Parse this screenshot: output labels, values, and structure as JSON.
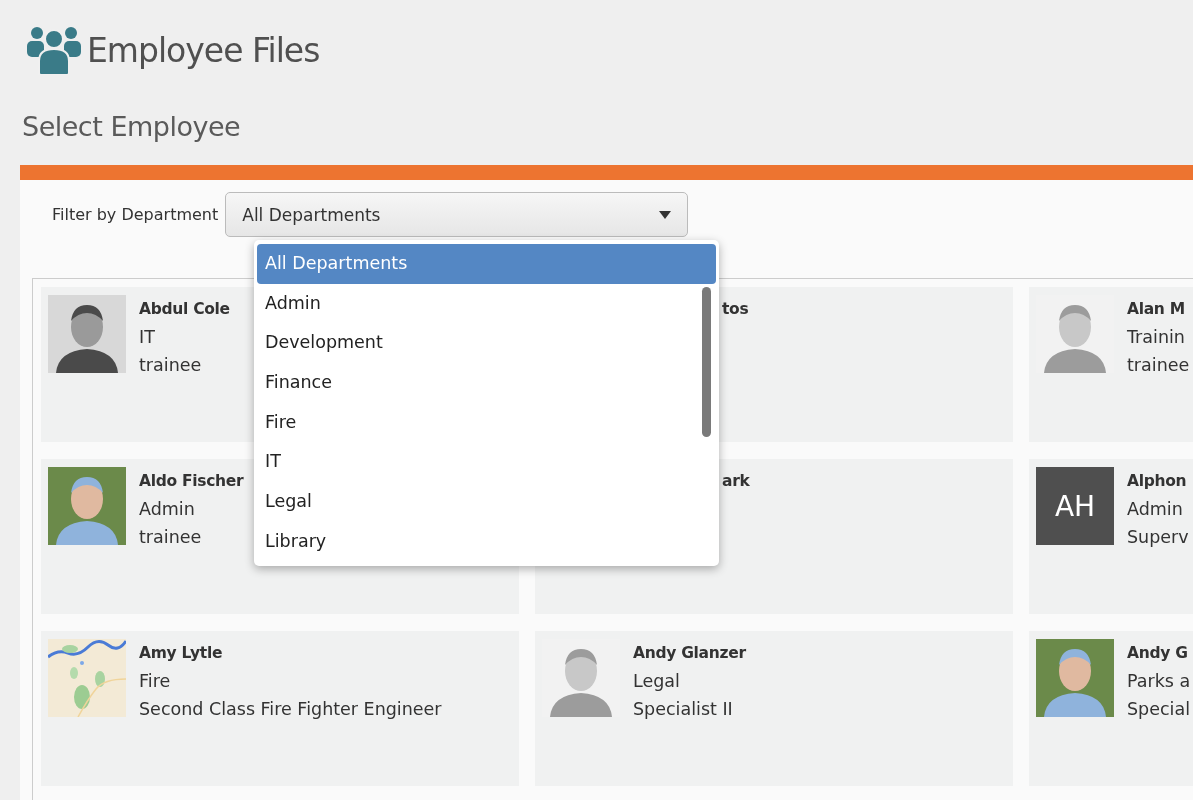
{
  "header": {
    "title": "Employee Files"
  },
  "page_title": "Select Employee",
  "filter": {
    "label": "Filter by Department",
    "value": "All Departments",
    "expanded": true,
    "options": [
      {
        "label": "All Departments",
        "selected": true
      },
      {
        "label": "Admin",
        "selected": false
      },
      {
        "label": "Development",
        "selected": false
      },
      {
        "label": "Finance",
        "selected": false
      },
      {
        "label": "Fire",
        "selected": false
      },
      {
        "label": "IT",
        "selected": false
      },
      {
        "label": "Legal",
        "selected": false
      },
      {
        "label": "Library",
        "selected": false
      }
    ]
  },
  "employees": [
    {
      "kind": "full",
      "name": "Abdul Cole",
      "department": "IT",
      "title": "trainee"
    },
    {
      "kind": "covered",
      "name": "tos"
    },
    {
      "kind": "full",
      "name": "Alan M",
      "department": "Trainin",
      "title": "trainee"
    },
    {
      "kind": "full",
      "name": "Aldo Fischer",
      "department": "Admin",
      "title": "trainee"
    },
    {
      "kind": "covered",
      "name": "ark"
    },
    {
      "kind": "full",
      "name": "Alphon",
      "department": "Admin",
      "title": "Superv",
      "avatar": {
        "kind": "initials",
        "initials": "AH"
      }
    },
    {
      "kind": "full",
      "name": "Amy Lytle",
      "department": "Fire",
      "title": "Second Class Fire Fighter Engineer"
    },
    {
      "kind": "full",
      "name": "Andy Glanzer",
      "department": "Legal",
      "title": "Specialist II"
    },
    {
      "kind": "full",
      "name": "Andy G",
      "department": "Parks a",
      "title": "Special"
    }
  ]
}
